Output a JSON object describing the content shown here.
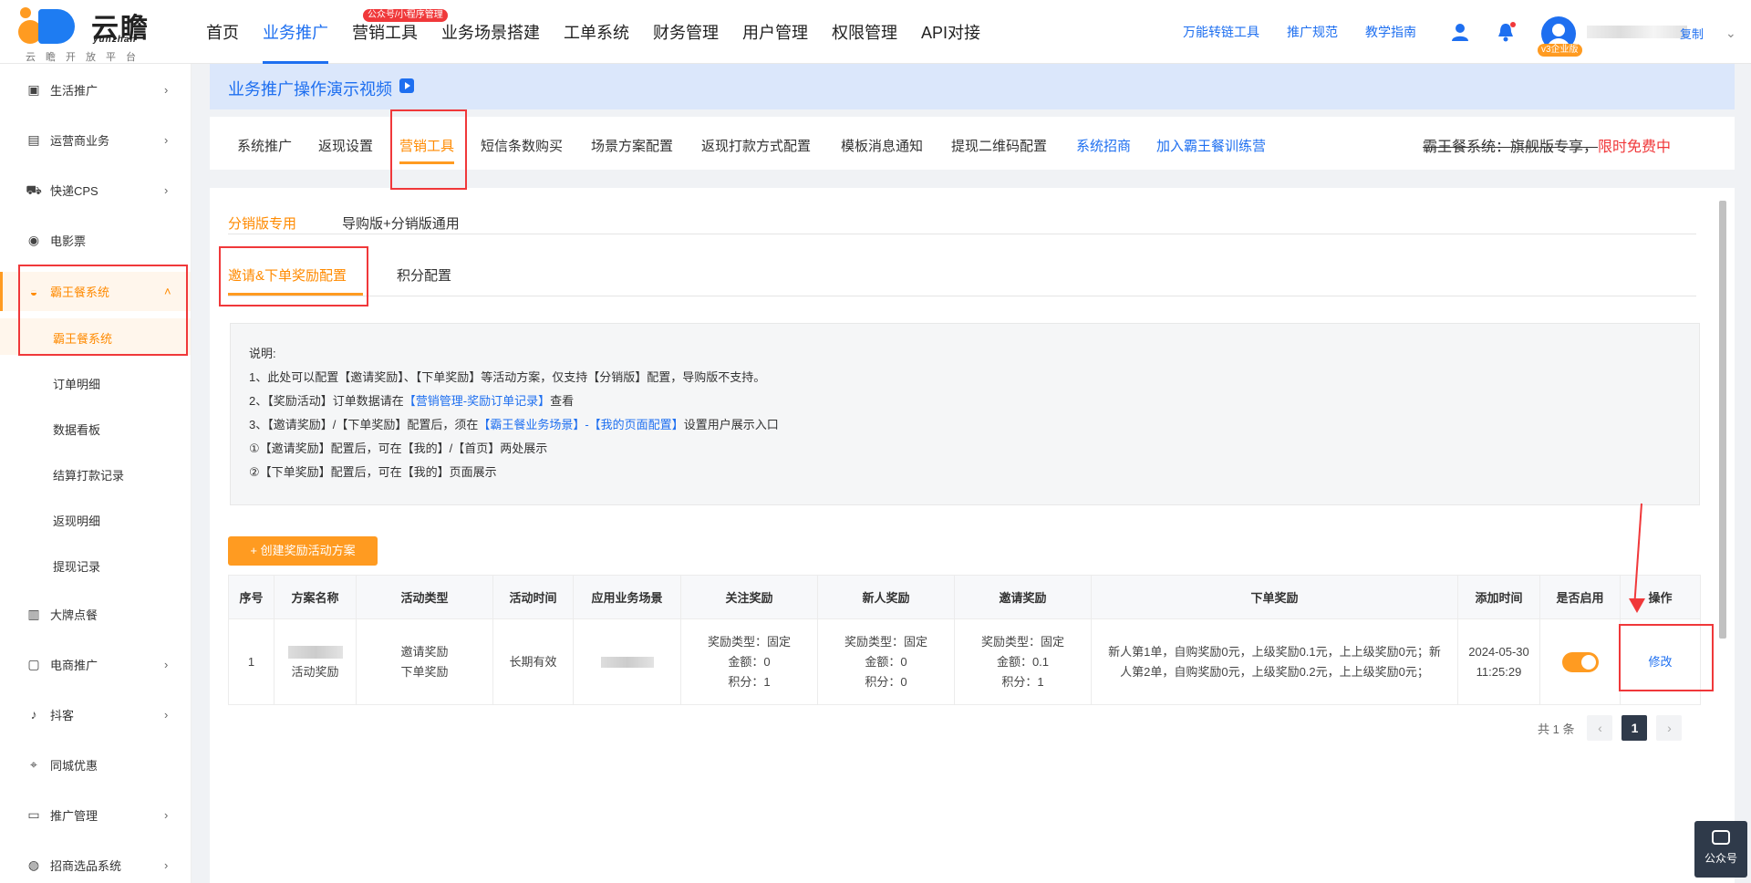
{
  "logo": {
    "name": "云瞻",
    "en": "yunzhan",
    "tagline": "云瞻开放平台"
  },
  "nav": {
    "items": [
      {
        "label": "首页",
        "active": false
      },
      {
        "label": "业务推广",
        "active": true
      },
      {
        "label": "营销工具",
        "active": false,
        "badge": "公众号/小程序管理"
      },
      {
        "label": "业务场景搭建",
        "active": false
      },
      {
        "label": "工单系统",
        "active": false
      },
      {
        "label": "财务管理",
        "active": false
      },
      {
        "label": "用户管理",
        "active": false
      },
      {
        "label": "权限管理",
        "active": false
      },
      {
        "label": "API对接",
        "active": false
      }
    ],
    "links": [
      "万能转链工具",
      "推广规范",
      "教学指南"
    ],
    "vip_badge": "v3企业版",
    "copy": "复制"
  },
  "sidebar": {
    "items": [
      {
        "label": "生活推广",
        "icon": "sofa-icon",
        "glyph": "▣",
        "chevron": true
      },
      {
        "label": "运营商业务",
        "icon": "sim-icon",
        "glyph": "▤",
        "chevron": true
      },
      {
        "label": "快递CPS",
        "icon": "truck-icon",
        "glyph": "⛟",
        "chevron": true
      },
      {
        "label": "电影票",
        "icon": "film-icon",
        "glyph": "◉",
        "chevron": false
      },
      {
        "label": "霸王餐系统",
        "icon": "dish-icon",
        "glyph": "◒",
        "chevron": true,
        "active": true,
        "expanded": true
      }
    ],
    "sub_items": [
      {
        "label": "霸王餐系统",
        "active": true
      },
      {
        "label": "订单明细",
        "active": false
      },
      {
        "label": "数据看板",
        "active": false
      },
      {
        "label": "结算打款记录",
        "active": false
      },
      {
        "label": "返现明细",
        "active": false
      },
      {
        "label": "提现记录",
        "active": false
      }
    ],
    "more_items": [
      {
        "label": "大牌点餐",
        "icon": "chart-icon",
        "glyph": "▥",
        "chevron": false
      },
      {
        "label": "电商推广",
        "icon": "cart-icon",
        "glyph": "▢",
        "chevron": true
      },
      {
        "label": "抖客",
        "icon": "tiktok-icon",
        "glyph": "♪",
        "chevron": true
      },
      {
        "label": "同城优惠",
        "icon": "location-icon",
        "glyph": "⌖",
        "chevron": false
      },
      {
        "label": "推广管理",
        "icon": "briefcase-icon",
        "glyph": "▭",
        "chevron": true
      },
      {
        "label": "招商选品系统",
        "icon": "store-icon",
        "glyph": "◍",
        "chevron": true
      }
    ]
  },
  "banner": {
    "text": "业务推广操作演示视频"
  },
  "subtabs": [
    {
      "label": "系统推广",
      "type": "normal"
    },
    {
      "label": "返现设置",
      "type": "normal"
    },
    {
      "label": "营销工具",
      "type": "active"
    },
    {
      "label": "短信条数购买",
      "type": "normal"
    },
    {
      "label": "场景方案配置",
      "type": "normal"
    },
    {
      "label": "返现打款方式配置",
      "type": "normal"
    },
    {
      "label": "模板消息通知",
      "type": "normal"
    },
    {
      "label": "提现二维码配置",
      "type": "normal"
    },
    {
      "label": "系统招商",
      "type": "link"
    },
    {
      "label": "加入霸王餐训练营",
      "type": "link"
    }
  ],
  "promo": {
    "strike": "霸王餐系统：旗舰版专享，",
    "free": "限时免费中"
  },
  "tier_tabs": [
    {
      "label": "分销版专用",
      "active": true
    },
    {
      "label": "导购版+分销版通用",
      "active": false
    }
  ],
  "config_tabs": [
    {
      "label": "邀请&下单奖励配置",
      "active": true
    },
    {
      "label": "积分配置",
      "active": false
    }
  ],
  "notes": {
    "title": "说明:",
    "line1": "1、此处可以配置【邀请奖励】、【下单奖励】等活动方案，仅支持【分销版】配置，导购版不支持。",
    "line2a": "2、【奖励活动】订单数据请在",
    "line2link": "【营销管理-奖励订单记录】",
    "line2b": "查看",
    "line3a": "3、【邀请奖励】/【下单奖励】配置后，须在",
    "line3link": "【霸王餐业务场景】-【我的页面配置】",
    "line3b": "设置用户展示入口",
    "line4": "①【邀请奖励】配置后，可在【我的】/【首页】两处展示",
    "line5": "②【下单奖励】配置后，可在【我的】页面展示"
  },
  "create_button": "+ 创建奖励活动方案",
  "table": {
    "headers": [
      "序号",
      "方案名称",
      "活动类型",
      "活动时间",
      "应用业务场景",
      "关注奖励",
      "新人奖励",
      "邀请奖励",
      "下单奖励",
      "添加时间",
      "是否启用",
      "操作"
    ],
    "rows": [
      {
        "index": "1",
        "name": "活动奖励",
        "type_line1": "邀请奖励",
        "type_line2": "下单奖励",
        "time": "长期有效",
        "follow_l1": "奖励类型：固定",
        "follow_l2": "金额：0",
        "follow_l3": "积分：1",
        "newbie_l1": "奖励类型：固定",
        "newbie_l2": "金额：0",
        "newbie_l3": "积分：0",
        "invite_l1": "奖励类型：固定",
        "invite_l2": "金额：0.1",
        "invite_l3": "积分：1",
        "order": "新人第1单，自购奖励0元，上级奖励0.1元，上上级奖励0元；新人第2单，自购奖励0元，上级奖励0.2元，上上级奖励0元；",
        "added": "2024-05-30 11:25:29",
        "enabled": true,
        "action": "修改"
      }
    ]
  },
  "pagination": {
    "total": "共 1 条",
    "prev": "‹",
    "current": "1",
    "next": "›"
  },
  "float_widget": {
    "label": "公众号"
  },
  "colors": {
    "accent": "#ff9b21",
    "primary": "#1e6ff0",
    "highlight": "#f0383a"
  }
}
